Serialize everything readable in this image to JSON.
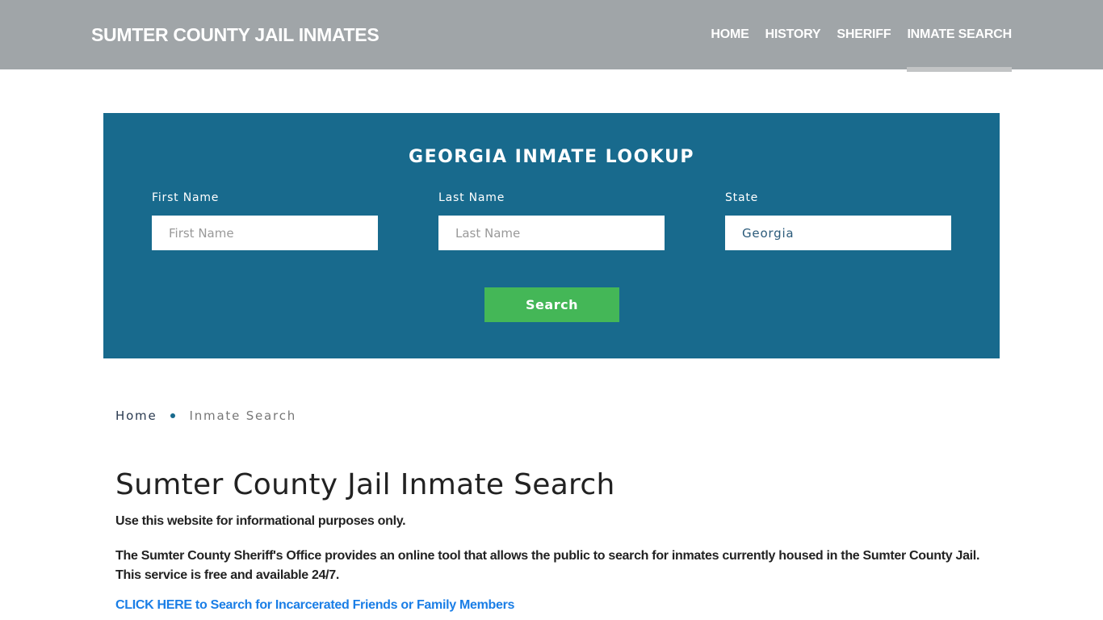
{
  "header": {
    "brand": "SUMTER COUNTY JAIL INMATES",
    "nav": [
      {
        "label": "HOME",
        "active": false
      },
      {
        "label": "HISTORY",
        "active": false
      },
      {
        "label": "SHERIFF",
        "active": false
      },
      {
        "label": "INMATE SEARCH",
        "active": true
      }
    ]
  },
  "lookup": {
    "title": "GEORGIA INMATE LOOKUP",
    "first_name": {
      "label": "First Name",
      "placeholder": "First Name",
      "value": ""
    },
    "last_name": {
      "label": "Last Name",
      "placeholder": "Last Name",
      "value": ""
    },
    "state": {
      "label": "State",
      "value": "Georgia"
    },
    "search_label": "Search"
  },
  "breadcrumb": {
    "home": "Home",
    "current": "Inmate Search"
  },
  "content": {
    "title": "Sumter County Jail Inmate Search",
    "disclaimer": "Use this website for informational purposes only.",
    "description": "The Sumter County Sheriff's Office provides an online tool that allows the public to search for inmates currently housed in the Sumter County Jail. This service is free and available 24/7.",
    "cta": "CLICK HERE to Search for Incarcerated Friends or Family Members"
  },
  "colors": {
    "header_bg": "#a0a5a8",
    "lookup_bg": "#186a8d",
    "search_button": "#44b757",
    "link": "#1a7ee6"
  }
}
